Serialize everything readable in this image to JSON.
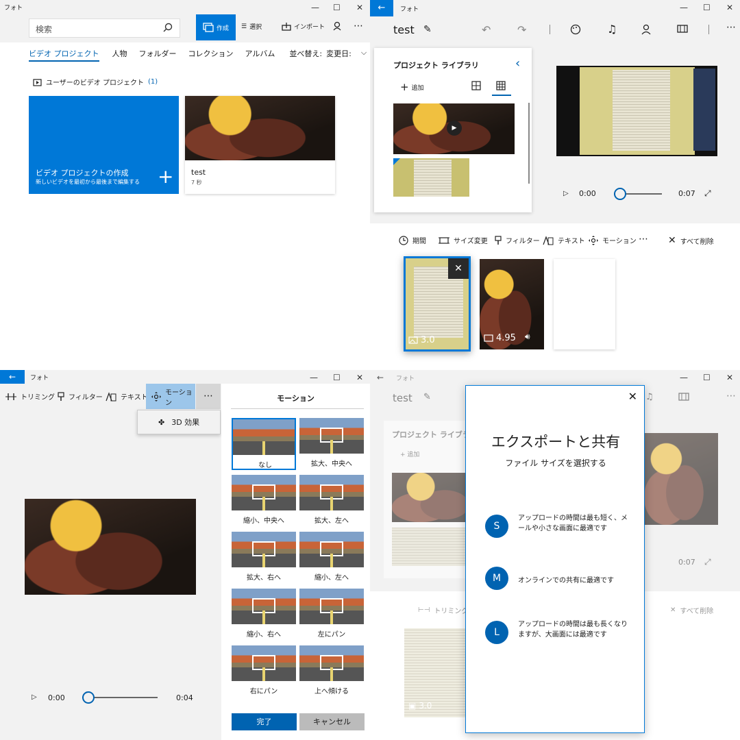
{
  "q1": {
    "app_title": "フォト",
    "search_placeholder": "検索",
    "toolbar": {
      "create": "作成",
      "select": "選択",
      "import": "インポート"
    },
    "nav_tabs": [
      {
        "label": "ビデオ プロジェクト"
      },
      {
        "label": "人物"
      },
      {
        "label": "フォルダー"
      },
      {
        "label": "コレクション"
      },
      {
        "label": "アルバム"
      }
    ],
    "sort": {
      "label": "並べ替え:",
      "value": "変更日:"
    },
    "section_title": "ユーザーのビデオ プロジェクト",
    "section_count": "(1)",
    "new_project": {
      "title": "ビデオ プロジェクトの作成",
      "subtitle": "新しいビデオを最初から最後まで編集する"
    },
    "project": {
      "name": "test",
      "duration": "7 秒"
    }
  },
  "q2": {
    "app_title": "フォト",
    "project_name": "test",
    "library_title": "プロジェクト ライブラリ",
    "add_label": "追加",
    "player": {
      "current": "0:00",
      "total": "0:07",
      "progress": 0
    },
    "toolbar": {
      "duration": "期間",
      "resize": "サイズ変更",
      "filter": "フィルター",
      "text": "テキスト",
      "motion": "モーション",
      "delete_all": "すべて削除"
    },
    "storyboard": [
      {
        "duration": "3.0",
        "type": "image-icon"
      },
      {
        "duration": "4.95",
        "type": "video-icon"
      }
    ]
  },
  "q3": {
    "app_title": "フォト",
    "toolbar": {
      "trim": "トリミング",
      "filter": "フィルター",
      "text": "テキスト",
      "motion": "モーション"
    },
    "dropdown_item": "3D 効果",
    "panel_title": "モーション",
    "motions": [
      {
        "label": "なし"
      },
      {
        "label": "拡大、中央へ"
      },
      {
        "label": "縮小、中央へ"
      },
      {
        "label": "拡大、左へ"
      },
      {
        "label": "拡大、右へ"
      },
      {
        "label": "縮小、左へ"
      },
      {
        "label": "縮小、右へ"
      },
      {
        "label": "左にパン"
      },
      {
        "label": "右にパン"
      },
      {
        "label": "上へ傾ける"
      }
    ],
    "player": {
      "current": "0:00",
      "total": "0:04",
      "progress": 0
    },
    "buttons": {
      "done": "完了",
      "cancel": "キャンセル"
    }
  },
  "q4": {
    "app_title": "フォト",
    "project_name": "test",
    "library_title": "プロジェクト ライブラリ",
    "add_label": "追加",
    "time_total": "0:07",
    "trim_label": "トリミング",
    "delete_all": "すべて削除",
    "story_duration": "3.0",
    "dialog": {
      "title": "エクスポートと共有",
      "subtitle": "ファイル サイズを選択する",
      "options": [
        {
          "letter": "S",
          "text": "アップロードの時間は最も短く、メールや小さな画面に最適です"
        },
        {
          "letter": "M",
          "text": "オンラインでの共有に最適です"
        },
        {
          "letter": "L",
          "text": "アップロードの時間は最も長くなりますが、大画面には最適です"
        }
      ]
    },
    "accent": "#0063b1"
  }
}
